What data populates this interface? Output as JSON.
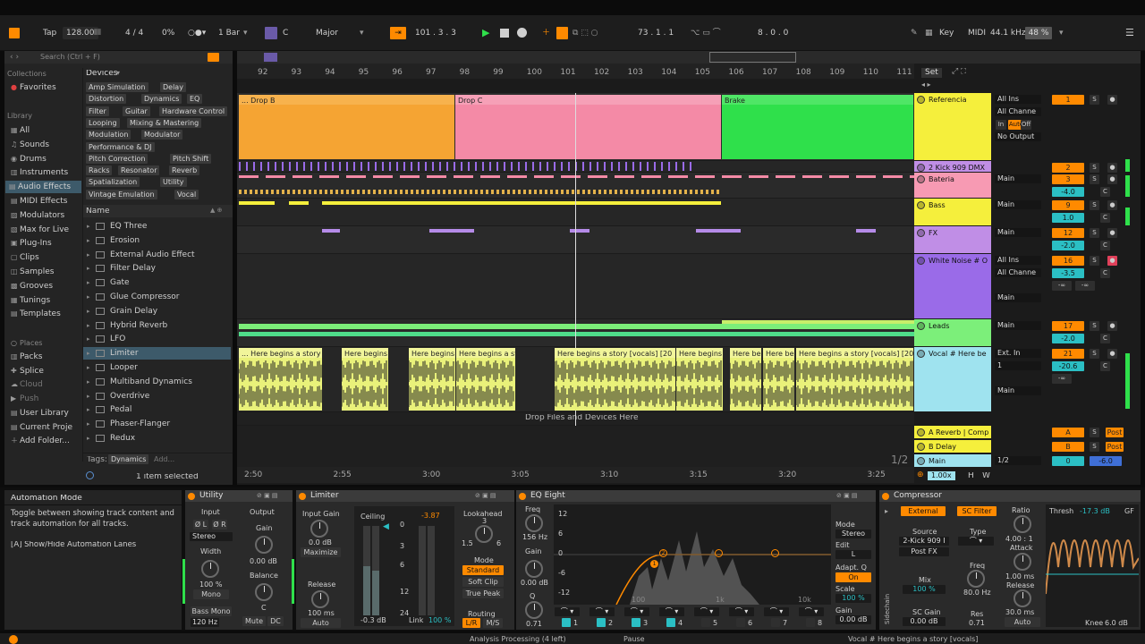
{
  "topbar": {
    "tap": "Tap",
    "tempo": "128.00",
    "signature": "4 / 4",
    "swing": "0%",
    "quantize": "1 Bar",
    "key_root": "C",
    "key_scale": "Major",
    "position": "101 .  3 .  3",
    "loop_start": "73 .  1 .  1",
    "loop_length": "8 .  0 .  0",
    "key_label": "Key",
    "midi_label": "MIDI",
    "sample_rate": "44.1 kHz",
    "cpu": "48 %"
  },
  "browser": {
    "search_placeholder": "Search (Ctrl + F)",
    "collections_header": "Collections",
    "favorites": "Favorites",
    "library_header": "Library",
    "library_items": [
      "All",
      "Sounds",
      "Drums",
      "Instruments",
      "Audio Effects",
      "MIDI Effects",
      "Modulators",
      "Max for Live",
      "Plug-Ins",
      "Clips",
      "Samples",
      "Grooves",
      "Tunings",
      "Templates"
    ],
    "places_header": "Places",
    "places_items": [
      "Packs",
      "Splice",
      "Cloud",
      "Push",
      "User Library",
      "Current Proje",
      "Add Folder..."
    ],
    "devices_header": "Devices",
    "device_tags": [
      [
        "Amp Simulation",
        "Delay"
      ],
      [
        "Distortion",
        "Dynamics",
        "EQ"
      ],
      [
        "Filter",
        "Guitar",
        "Hardware Control"
      ],
      [
        "Looping",
        "Mixing & Mastering"
      ],
      [
        "Modulation",
        "Modulator"
      ],
      [
        "Performance & DJ"
      ],
      [
        "Pitch Correction",
        "Pitch Shift"
      ],
      [
        "Racks",
        "Resonator",
        "Reverb"
      ],
      [
        "Spatialization",
        "Utility"
      ],
      [
        "Vintage Emulation",
        "Vocal"
      ]
    ],
    "name_header": "Name",
    "devices": [
      "EQ Three",
      "Erosion",
      "External Audio Effect",
      "Filter Delay",
      "Gate",
      "Glue Compressor",
      "Grain Delay",
      "Hybrid Reverb",
      "LFO",
      "Limiter",
      "Looper",
      "Multiband Dynamics",
      "Overdrive",
      "Pedal",
      "Phaser-Flanger",
      "Redux"
    ],
    "tags_label": "Tags:",
    "tag_active": "Dynamics",
    "tag_add": "Add...",
    "status": "1 item selected"
  },
  "arrangement": {
    "bars": [
      "92",
      "93",
      "94",
      "95",
      "96",
      "97",
      "98",
      "99",
      "100",
      "101",
      "102",
      "103",
      "104",
      "105",
      "106",
      "107",
      "108",
      "109",
      "110",
      "111"
    ],
    "set_label": "Set",
    "times": [
      "2:50",
      "2:55",
      "3:00",
      "3:05",
      "3:10",
      "3:15",
      "3:20",
      "3:25"
    ],
    "zoom": "1/2",
    "clips": {
      "drop_b": "... Drop B",
      "drop_c": "Drop C",
      "brake": "Brake",
      "vocal": "... Here begins a story",
      "vocal2": "Here begins",
      "vocal3": "Here begins",
      "vocal4": "Here begins a st",
      "vocal5": "Here begins a story [vocals] [20",
      "vocal6": "Here begins",
      "vocal7": "Here be",
      "vocal8": "Here be",
      "vocal9": "Here begins a story [vocals] [20"
    },
    "drop_hint": "Drop Files and Devices Here",
    "tempo_factor": "1.00x",
    "h": "H",
    "w": "W"
  },
  "tracks": [
    {
      "name": "Referencia",
      "color": "#f5ef3c",
      "num": "1",
      "route": "All Ins",
      "route2": "All Channe",
      "monitor": [
        "In",
        "Auto",
        "Off"
      ],
      "out": "No Output"
    },
    {
      "name": "2 Kick 909 DMX",
      "color": "#c08ee6",
      "num": "2"
    },
    {
      "name": "Bateria",
      "color": "#f79ab3",
      "num": "3",
      "route": "Main",
      "vol": "-4.0",
      "pan": "C"
    },
    {
      "name": "Bass",
      "color": "#f5ef3c",
      "num": "9",
      "route": "Main",
      "vol": "1.0",
      "pan": "C"
    },
    {
      "name": "FX",
      "color": "#c08ee6",
      "num": "12",
      "route": "Main",
      "vol": "-2.0",
      "pan": "C"
    },
    {
      "name": "White Noise # O",
      "color": "#9a6be8",
      "num": "16",
      "route": "All Ins",
      "route2": "All Channe",
      "vol": "-3.5",
      "pan": "C",
      "out": "Main",
      "inf1": "-∞",
      "inf2": "-∞"
    },
    {
      "name": "Leads",
      "color": "#7cef7a",
      "num": "17",
      "route": "Main",
      "vol": "-2.0",
      "pan": "C"
    },
    {
      "name": "Vocal # Here be",
      "color": "#9fe3ef",
      "num": "21",
      "route": "Ext. In",
      "route2": "1",
      "vol": "-20.6",
      "pan": "C",
      "out": "Main",
      "inf1": "-∞"
    },
    {
      "name": "A Reverb | Comp",
      "color": "#f5ef3c",
      "num": "A",
      "post": "Post"
    },
    {
      "name": "B Delay",
      "color": "#f5ef3c",
      "num": "B",
      "post": "Post"
    },
    {
      "name": "Main",
      "color": "#9fe3ef",
      "num": "0",
      "route": "1/2",
      "vol": "-6.0"
    }
  ],
  "info": {
    "title": "Automation Mode",
    "body": "Toggle between showing track content and track automation for all tracks.",
    "shortcut": "[A] Show/Hide Automation Lanes"
  },
  "utility": {
    "title": "Utility",
    "input": "Input",
    "output": "Output",
    "phase_l": "Ø L",
    "phase_r": "Ø R",
    "mode": "Stereo",
    "gain_label": "Gain",
    "gain": "0.00 dB",
    "width_label": "Width",
    "width": "100 %",
    "mono": "Mono",
    "balance_label": "Balance",
    "balance": "C",
    "bass_mono": "Bass Mono",
    "bass_freq": "120 Hz",
    "mute": "Mute",
    "dc": "DC"
  },
  "limiter": {
    "title": "Limiter",
    "input_gain_label": "Input Gain",
    "input_gain": "0.0 dB",
    "maximize": "Maximize",
    "release_label": "Release",
    "release": "100 ms",
    "auto": "Auto",
    "ceiling_label": "Ceiling",
    "ceiling": "-3.87",
    "scale": [
      "0",
      "3",
      "6",
      "12",
      "24"
    ],
    "ceiling_db": "-0.3 dB",
    "link_label": "Link",
    "link": "100 %",
    "lookahead_label": "Lookahead",
    "lookahead_mid": "3",
    "lookahead_lo": "1.5",
    "lookahead_hi": "6",
    "mode_label": "Mode",
    "mode_options": [
      "Standard",
      "Soft Clip",
      "True Peak"
    ],
    "routing_label": "Routing",
    "routing_lr": "L/R",
    "routing_ms": "M/S"
  },
  "eq": {
    "title": "EQ Eight",
    "freq_label": "Freq",
    "freq": "156 Hz",
    "gain_label": "Gain",
    "gain": "0.00 dB",
    "q_label": "Q",
    "q": "0.71",
    "db_scale": [
      "12",
      "6",
      "0",
      "-6",
      "-12"
    ],
    "freq_scale": [
      "100",
      "1k",
      "10k"
    ],
    "mode_label": "Mode",
    "mode": "Stereo",
    "edit_label": "Edit",
    "edit": "L",
    "adaptq_label": "Adapt. Q",
    "adaptq": "On",
    "scale_label": "Scale",
    "scale": "100 %",
    "out_gain_label": "Gain",
    "out_gain": "0.00 dB",
    "bands": [
      "1",
      "2",
      "3",
      "4",
      "5",
      "6",
      "7",
      "8"
    ]
  },
  "comp": {
    "title": "Compressor",
    "external": "External",
    "sc_filter": "SC Filter",
    "source_label": "Source",
    "source": "2-Kick 909 I",
    "source2": "Post FX",
    "type_label": "Type",
    "mix_label": "Mix",
    "mix": "100 %",
    "sc_gain_label": "SC Gain",
    "sc_gain": "0.00 dB",
    "freq_label": "Freq",
    "freq": "80.0 Hz",
    "res_label": "Res",
    "res": "0.71",
    "ratio_label": "Ratio",
    "ratio": "4.00 : 1",
    "attack_label": "Attack",
    "attack": "1.00 ms",
    "release_label": "Release",
    "release": "30.0 ms",
    "auto": "Auto",
    "thresh_label": "Thresh",
    "thresh": "-17.3 dB",
    "knee_label": "Knee",
    "knee": "6.0 dB",
    "gr": "GF",
    "sidechain": "Sidechain"
  },
  "statusbar": {
    "left": "Analysis Processing (4 left)",
    "mid": "Pause",
    "right": "Vocal # Here begins a story [vocals]"
  },
  "colors": {
    "accent": "#ff8a00",
    "orange_clip": "#f5a433",
    "pink_clip": "#f48aa6",
    "green_clip": "#2fe04b",
    "yellow_clip": "#e9f17a",
    "selection": "#3d5a6a"
  }
}
